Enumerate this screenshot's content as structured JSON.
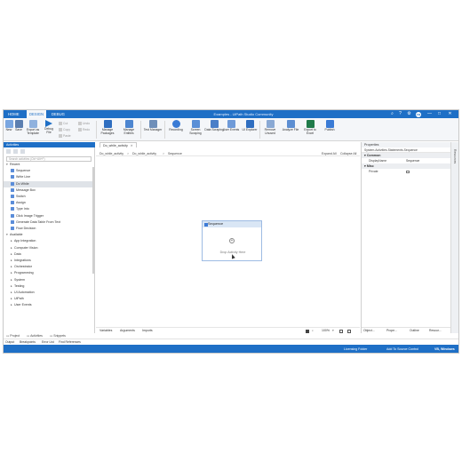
{
  "window": {
    "title": "Examples - UiPath Studio Community",
    "tabs": [
      "HOME",
      "DESIGN",
      "DEBUG"
    ],
    "active_tab": "DESIGN",
    "user_initials": "FB",
    "controls": {
      "minimize": "—",
      "maximize": "□",
      "close": "✕",
      "help": "?",
      "settings": "⚙"
    }
  },
  "ribbon": {
    "new": "New",
    "save": "Save",
    "export_template": "Export as Template",
    "debug_file": "Debug File",
    "cut": "Cut",
    "copy": "Copy",
    "paste": "Paste",
    "undo": "Undo",
    "redo": "Redo",
    "manage_packages": "Manage Packages",
    "manage_entities": "Manage Entities",
    "test_manager": "Test Manager",
    "recording": "Recording",
    "screen_scraping": "Screen Scraping",
    "data_scraping": "Data Scraping",
    "user_events": "User Events",
    "ui_explorer": "UI Explorer",
    "remove_unused": "Remove Unused",
    "analyze_file": "Analyze File",
    "export_to_excel": "Export to Excel",
    "publish": "Publish"
  },
  "activities_panel": {
    "title": "Activities",
    "search_placeholder": "Search activities (Ctrl+Alt+F)",
    "items": [
      {
        "label": "Recent",
        "arrow": "▾",
        "level": 0
      },
      {
        "label": "Sequence",
        "level": 1
      },
      {
        "label": "Write Line",
        "level": 1
      },
      {
        "label": "Do While",
        "level": 1,
        "selected": true
      },
      {
        "label": "Message Box",
        "level": 1
      },
      {
        "label": "Switch",
        "level": 1
      },
      {
        "label": "Assign",
        "level": 1
      },
      {
        "label": "Type Into",
        "level": 1
      },
      {
        "label": "Click Image Trigger",
        "level": 1
      },
      {
        "label": "Generate Data Table From Text",
        "level": 1
      },
      {
        "label": "Flow Decision",
        "level": 1
      },
      {
        "label": "Available",
        "arrow": "▾",
        "level": 0
      },
      {
        "label": "App Integration",
        "arrow": "▸",
        "level": 1
      },
      {
        "label": "Computer Vision",
        "arrow": "▸",
        "level": 1
      },
      {
        "label": "Data",
        "arrow": "▸",
        "level": 1
      },
      {
        "label": "Integrations",
        "arrow": "▸",
        "level": 1
      },
      {
        "label": "Orchestrator",
        "arrow": "▸",
        "level": 1
      },
      {
        "label": "Programming",
        "arrow": "▸",
        "level": 1
      },
      {
        "label": "System",
        "arrow": "▸",
        "level": 1
      },
      {
        "label": "Testing",
        "arrow": "▸",
        "level": 1
      },
      {
        "label": "UI Automation",
        "arrow": "▸",
        "level": 1
      },
      {
        "label": "UiPath",
        "arrow": "▸",
        "level": 1
      },
      {
        "label": "User Events",
        "arrow": "▸",
        "level": 1
      }
    ]
  },
  "bottom_left_tabs": [
    "Project",
    "Activities",
    "Snippets"
  ],
  "output_tabs": [
    "Output",
    "Breakpoints",
    "Error List",
    "Find References"
  ],
  "document": {
    "tab_label": "Do_while_activity",
    "tab_close": "✕",
    "breadcrumb": [
      "Do_while_activity",
      "Do_while_activity",
      "Sequence"
    ],
    "expand_all": "Expand All",
    "collapse_all": "Collapse All",
    "sequence_title": "Sequence",
    "drop_hint": "Drop Activity Here",
    "bottom_tabs": [
      "Variables",
      "Arguments",
      "Imports"
    ],
    "zoom": "100%"
  },
  "properties_panel": {
    "title": "Properties",
    "subtitle": "System.Activities.Statements.Sequence",
    "sections": [
      {
        "name": "Common",
        "rows": [
          {
            "key": "DisplayName",
            "value": "Sequence"
          }
        ]
      },
      {
        "name": "Misc",
        "rows": [
          {
            "key": "Private",
            "value": ""
          }
        ]
      }
    ],
    "bottom_tabs": [
      "Object...",
      "Prope...",
      "Outline",
      "Resour..."
    ],
    "side_label": "Resources"
  },
  "status_bar": {
    "licensing": "Licensing Folder",
    "source_control": "Add To Source Control",
    "language": "VB, Windows"
  },
  "colors": {
    "accent": "#1e6fc6",
    "ribbon_bg": "#f4f6f9",
    "selected_row": "#dfe3e8",
    "sequence_header": "#d9e6f5"
  }
}
